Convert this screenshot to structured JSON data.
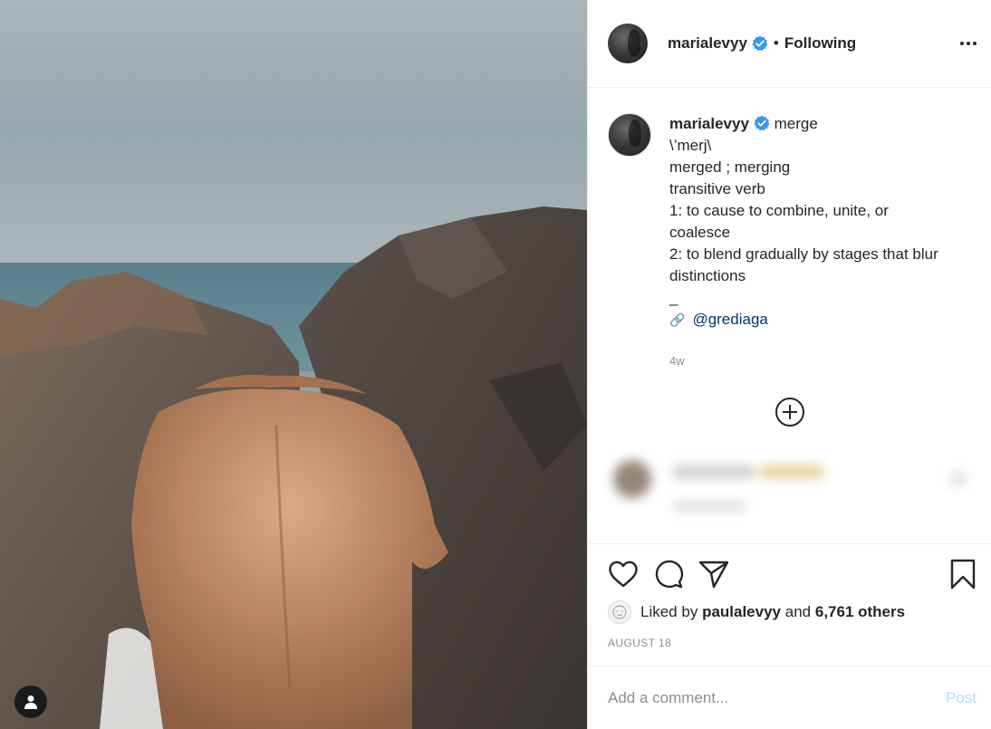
{
  "post": {
    "author": "marialevyy",
    "follow_separator": "•",
    "follow_status": "Following",
    "caption_lines": [
      "merge",
      "\\’merj\\",
      "merged ; merging",
      "transitive verb",
      "1: to cause to combine, unite, or coalesce",
      "2: to blend gradually by stages that blur distinctions",
      "_"
    ],
    "credit_emoji": "🔗",
    "credit_mention": "@grediaga",
    "time_ago": "4w",
    "liked_prefix": "Liked by",
    "liked_user": "paulalevyy",
    "liked_and": "and",
    "liked_others": "6,761 others",
    "date": "AUGUST 18"
  },
  "comment_box": {
    "placeholder": "Add a comment...",
    "post_label": "Post"
  },
  "icons": {
    "verified": "verified-badge-icon",
    "more": "more-options-icon",
    "like": "heart-icon",
    "comment": "comment-bubble-icon",
    "share": "paper-plane-icon",
    "save": "bookmark-icon",
    "tags": "person-tag-icon",
    "load_more": "plus-circle-icon"
  },
  "colors": {
    "verified": "#3897f0",
    "link": "#00376b",
    "muted": "#8e8e8e",
    "post_disabled": "#b2dffc"
  }
}
